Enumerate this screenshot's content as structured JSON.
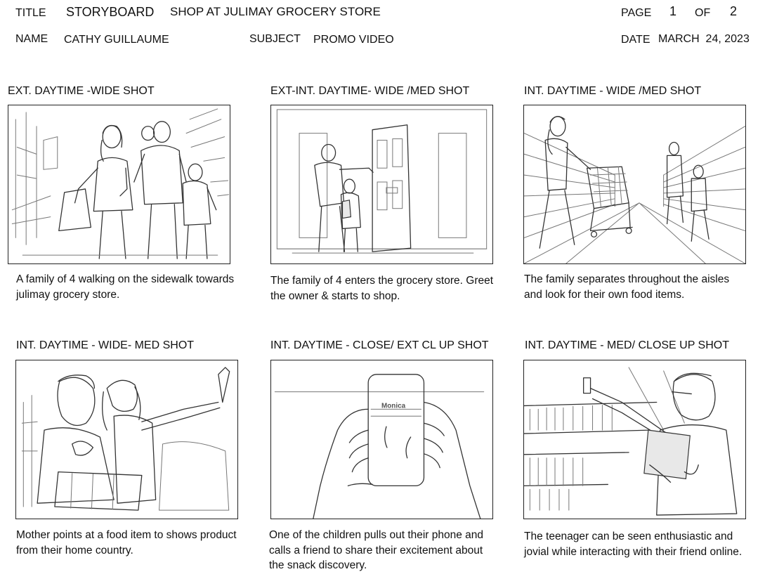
{
  "header": {
    "title_label": "TITLE",
    "title_type": "STORYBOARD",
    "title_value": "SHOP AT JULIMAY GROCERY STORE",
    "page_label": "PAGE",
    "page_number": "1",
    "of_label": "OF",
    "page_total": "2",
    "name_label": "NAME",
    "name_value": "CATHY GUILLAUME",
    "subject_label": "SUBJECT",
    "subject_value": "PROMO VIDEO",
    "date_label": "DATE",
    "date_value": "MARCH  24, 2023"
  },
  "panels": [
    {
      "scene": "EXT. DAYTIME -WIDE SHOT",
      "caption": "A family of 4 walking on the sidewalk towards julimay grocery store.",
      "sketch": "family-walking-sidewalk"
    },
    {
      "scene": "EXT-INT. DAYTIME- WIDE /MED SHOT",
      "caption": "The family of 4 enters the grocery store. Greet the owner & starts to shop.",
      "sketch": "family-entering-door"
    },
    {
      "scene": "INT. DAYTIME - WIDE /MED SHOT",
      "caption": "The family separates throughout the aisles and look for their own food items.",
      "sketch": "woman-pushing-cart-aisle"
    },
    {
      "scene": "INT. DAYTIME - WIDE- MED SHOT",
      "caption": "Mother points at a food item to shows product from their home country.",
      "sketch": "mother-pointing-shelf"
    },
    {
      "scene": "INT. DAYTIME - CLOSE/ EXT CL UP SHOT",
      "caption": "One of the children pulls out their phone and calls a friend to share their  excitement about the snack discovery.",
      "sketch": "hands-holding-phone",
      "phone_screen_text": "Monica"
    },
    {
      "scene": "INT. DAYTIME - MED/ CLOSE UP  SHOT",
      "caption": "The teenager can be seen enthusiastic and jovial while interacting with their friend online.",
      "sketch": "teen-with-tablet-shelf"
    }
  ]
}
